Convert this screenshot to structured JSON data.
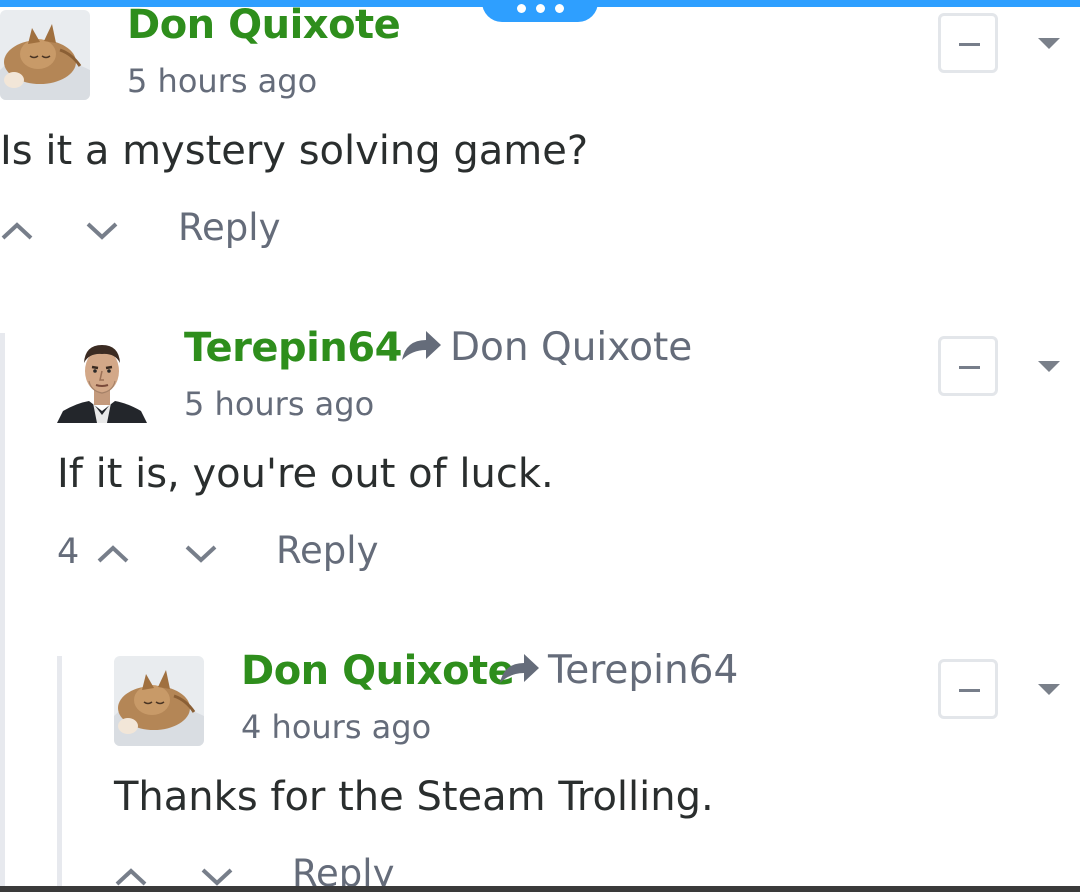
{
  "comments": [
    {
      "author": "Don Quixote",
      "time": "5 hours ago",
      "body": "Is it a mystery solving game?",
      "reply_label": "Reply"
    },
    {
      "author": "Terepin64",
      "reply_to": "Don Quixote",
      "time": "5 hours ago",
      "body": "If it is, you're out of luck.",
      "vote_count": "4",
      "reply_label": "Reply"
    },
    {
      "author": "Don Quixote",
      "reply_to": "Terepin64",
      "time": "4 hours ago",
      "body": "Thanks for the Steam Trolling.",
      "reply_label": "Reply"
    }
  ],
  "colors": {
    "accent": "#2e9fff",
    "author": "#2e8e1c",
    "meta": "#656c7a",
    "text": "#2a2e2e"
  },
  "icons": [
    "more-dots-icon",
    "reply-arrow-icon",
    "upvote-icon",
    "downvote-icon",
    "collapse-minus-icon",
    "menu-caret-icon"
  ]
}
